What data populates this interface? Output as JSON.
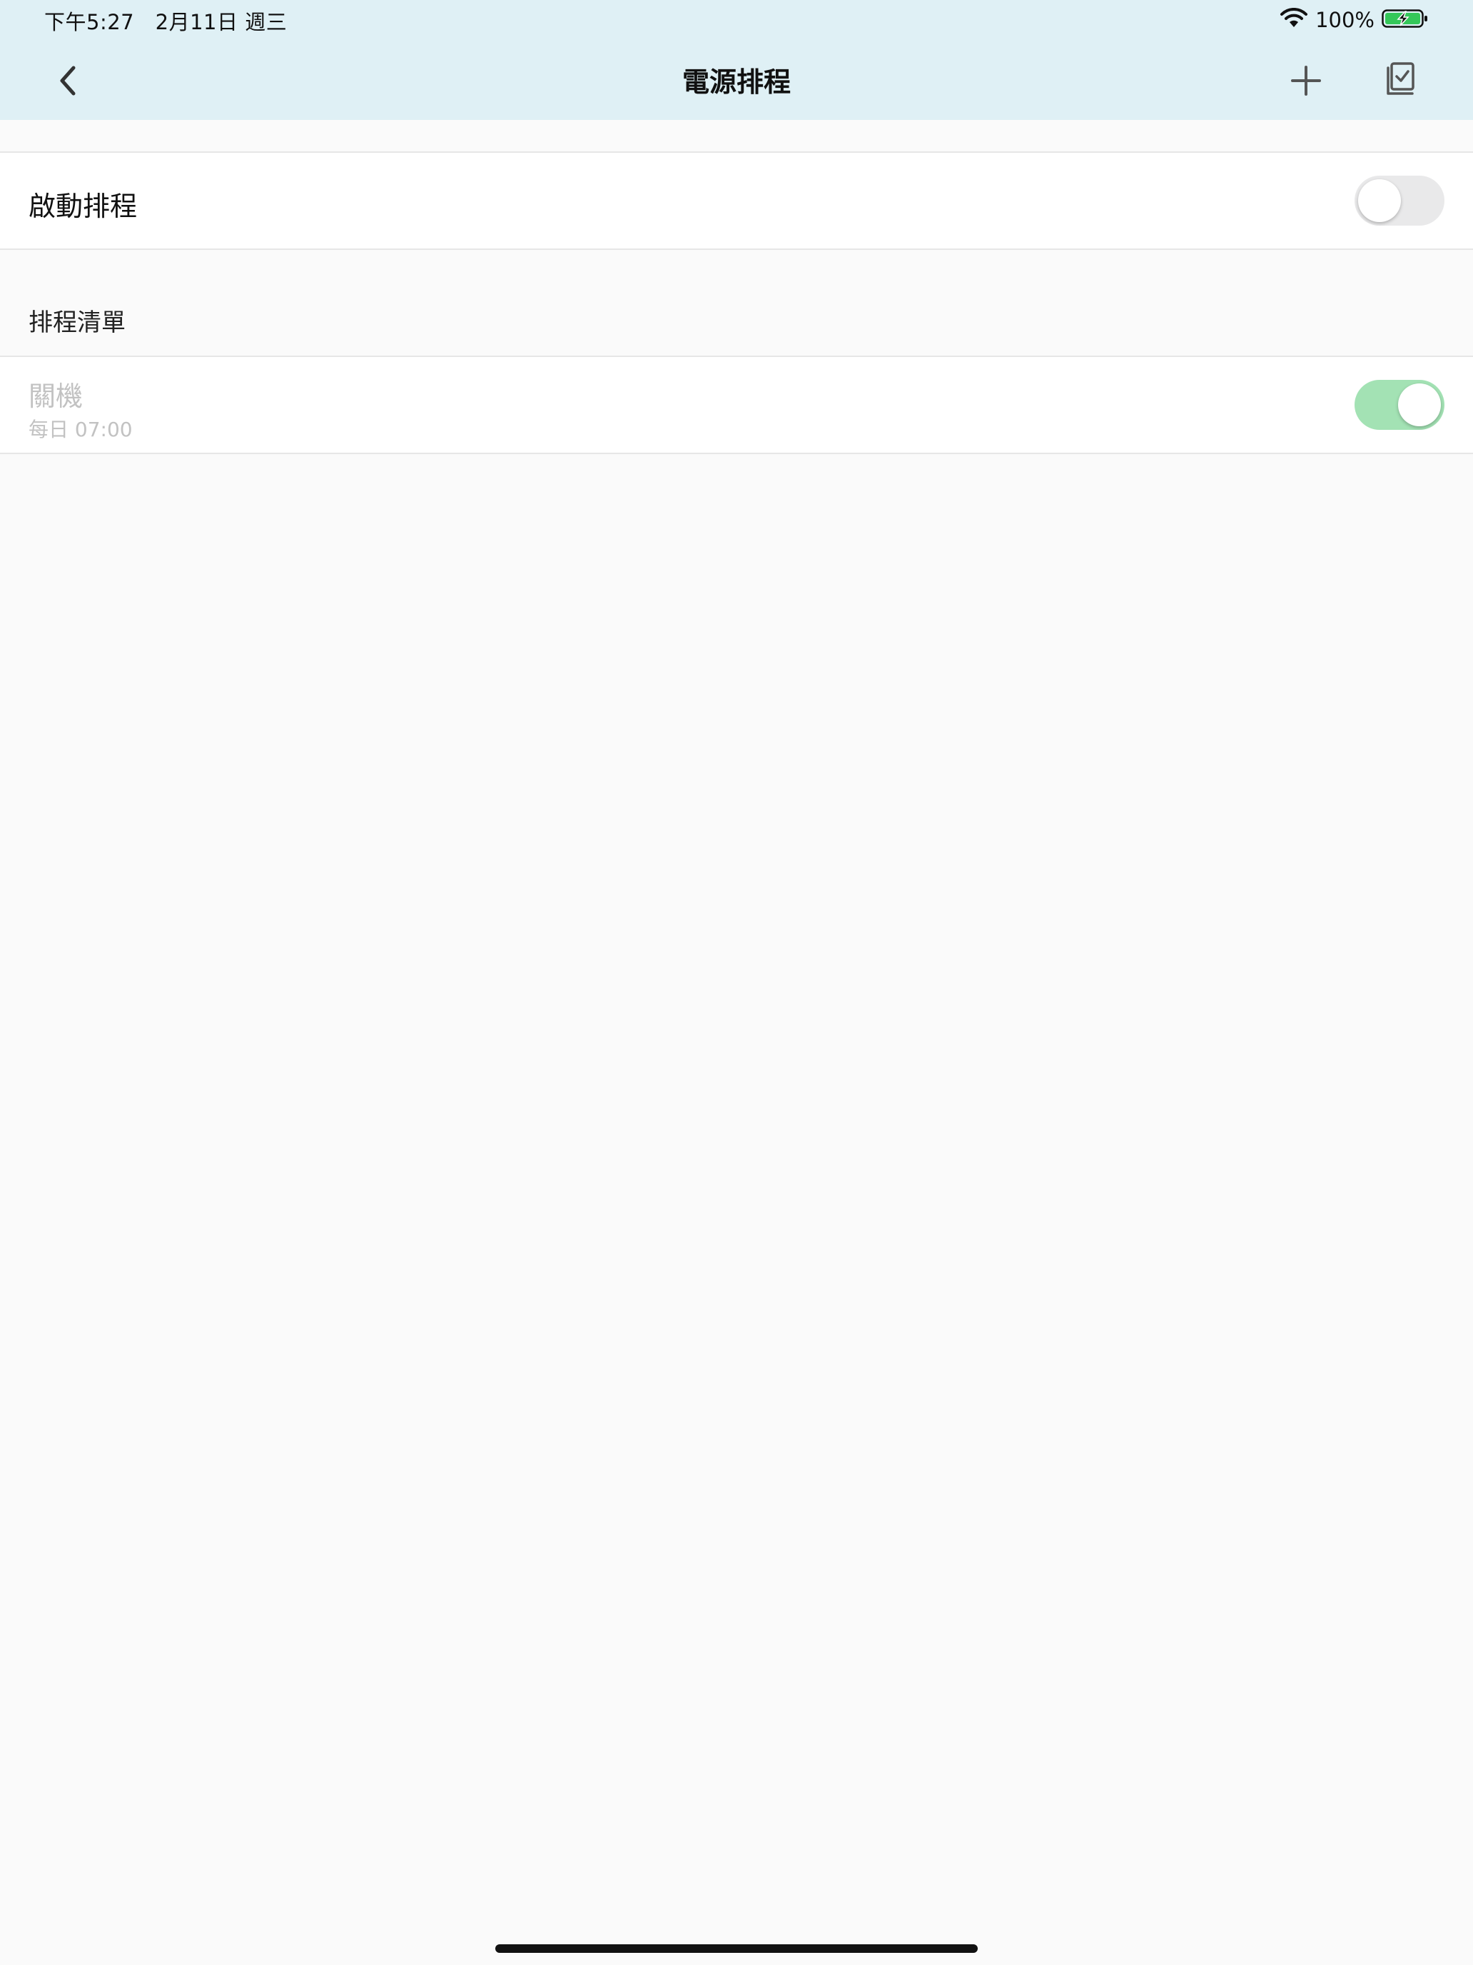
{
  "status_bar": {
    "time_date": "下午5:27　2月11日 週三",
    "battery_percent": "100%",
    "icons": [
      "wifi-icon",
      "battery-charging-icon"
    ]
  },
  "nav": {
    "title": "電源排程",
    "back_icon": "chevron-left-icon",
    "add_icon": "plus-icon",
    "select_icon": "multi-select-checkbox-icon"
  },
  "enable_schedule": {
    "label": "啟動排程",
    "enabled": false
  },
  "schedule_list": {
    "header": "排程清單",
    "items": [
      {
        "title": "關機",
        "subtitle": "每日 07:00",
        "enabled": true
      }
    ]
  },
  "colors": {
    "header_bg": "#dff0f5",
    "page_bg": "#fafafa",
    "toggle_on": "#a3e2b4",
    "toggle_off": "#e9e9ea",
    "battery_green": "#34c759",
    "disabled_text": "#c2c2c2"
  }
}
